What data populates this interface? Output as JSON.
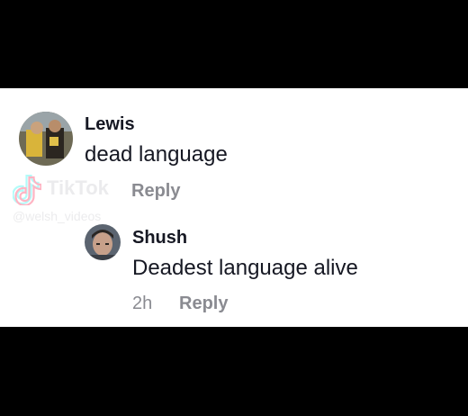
{
  "comments": [
    {
      "author": "Lewis",
      "text": "dead language",
      "reply_label": "Reply"
    },
    {
      "author": "Shush",
      "text": "Deadest language alive",
      "time": "2h",
      "reply_label": "Reply"
    }
  ],
  "watermark": {
    "brand": "TikTok",
    "handle": "@welsh_videos"
  },
  "colors": {
    "background": "#000000",
    "panel": "#ffffff",
    "text": "#161823",
    "muted": "#8a8b91"
  }
}
